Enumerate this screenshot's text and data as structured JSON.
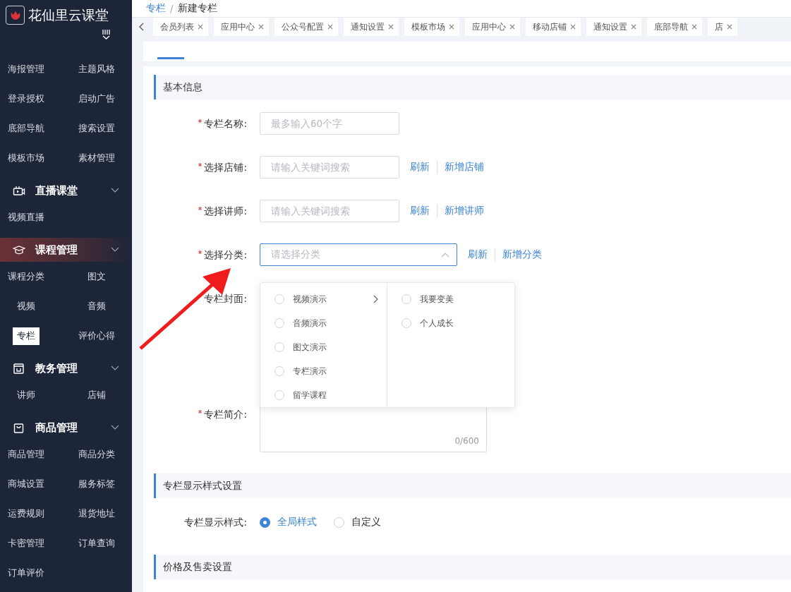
{
  "app": {
    "name": "花仙里云课堂"
  },
  "sidebar": {
    "sections": [
      {
        "kind": "grid",
        "items": [
          {
            "label": "海报管理",
            "selected": false
          },
          {
            "label": "主题风格",
            "selected": false
          },
          {
            "label": "登录授权",
            "selected": false
          },
          {
            "label": "启动广告",
            "selected": false
          },
          {
            "label": "底部导航",
            "selected": false
          },
          {
            "label": "搜索设置",
            "selected": false
          },
          {
            "label": "模板市场",
            "selected": false
          },
          {
            "label": "素材管理",
            "selected": false
          }
        ]
      },
      {
        "kind": "group",
        "title": "直播课堂",
        "active": false,
        "items": [
          {
            "label": "视频直播",
            "selected": false
          }
        ]
      },
      {
        "kind": "group",
        "title": "课程管理",
        "active": true,
        "items": [
          {
            "label": "课程分类",
            "selected": false
          },
          {
            "label": "图文",
            "selected": false
          },
          {
            "label": "视频",
            "selected": false
          },
          {
            "label": "音频",
            "selected": false
          },
          {
            "label": "专栏",
            "selected": true
          },
          {
            "label": "评价心得",
            "selected": false
          }
        ]
      },
      {
        "kind": "group",
        "title": "教务管理",
        "active": false,
        "items": [
          {
            "label": "讲师",
            "selected": false
          },
          {
            "label": "店铺",
            "selected": false
          }
        ]
      },
      {
        "kind": "group",
        "title": "商品管理",
        "active": false,
        "items": [
          {
            "label": "商品管理",
            "selected": false
          },
          {
            "label": "商品分类",
            "selected": false
          },
          {
            "label": "商城设置",
            "selected": false
          },
          {
            "label": "服务标签",
            "selected": false
          },
          {
            "label": "运费规则",
            "selected": false
          },
          {
            "label": "退货地址",
            "selected": false
          },
          {
            "label": "卡密管理",
            "selected": false
          },
          {
            "label": "订单查询",
            "selected": false
          },
          {
            "label": "订单评价",
            "selected": false
          }
        ]
      }
    ]
  },
  "breadcrumb": {
    "items": [
      {
        "label": "专栏",
        "link": true
      },
      {
        "label": "新建专栏",
        "link": false
      }
    ],
    "separator": "/"
  },
  "open_tabs": [
    {
      "label": "会员列表"
    },
    {
      "label": "应用中心"
    },
    {
      "label": "公众号配置"
    },
    {
      "label": "通知设置"
    },
    {
      "label": "模板市场"
    },
    {
      "label": "应用中心"
    },
    {
      "label": "移动店铺"
    },
    {
      "label": "通知设置"
    },
    {
      "label": "底部导航"
    },
    {
      "label": "店"
    }
  ],
  "sections": [
    {
      "title": "基本信息",
      "fields": [
        {
          "kind": "text",
          "label": "专栏名称:",
          "required": true,
          "placeholder": "最多输入60个字"
        },
        {
          "kind": "text",
          "label": "选择店铺:",
          "required": true,
          "placeholder": "请输入关键词搜索",
          "links": [
            "刷新",
            "新增店铺"
          ]
        },
        {
          "kind": "text",
          "label": "选择讲师:",
          "required": true,
          "placeholder": "请输入关键词搜索",
          "links": [
            "刷新",
            "新增讲师"
          ]
        },
        {
          "kind": "select",
          "label": "选择分类:",
          "required": true,
          "placeholder": "请选择分类",
          "expanded": true,
          "links": [
            "刷新",
            "新增分类"
          ],
          "options": [
            [
              {
                "label": "视频演示",
                "has_children": true,
                "selected": false
              },
              {
                "label": "音频演示",
                "has_children": false,
                "selected": false
              },
              {
                "label": "图文演示",
                "has_children": false,
                "selected": false
              },
              {
                "label": "专栏演示",
                "has_children": false,
                "selected": false
              },
              {
                "label": "留学课程",
                "has_children": false,
                "selected": false
              }
            ],
            [
              {
                "label": "我要变美",
                "has_children": false,
                "selected": false
              },
              {
                "label": "个人成长",
                "has_children": false,
                "selected": false
              }
            ]
          ]
        },
        {
          "kind": "cover",
          "label": "专栏封面:",
          "required": false
        },
        {
          "kind": "textarea",
          "label": "专栏简介:",
          "required": true,
          "counter": "0/600"
        }
      ]
    },
    {
      "title": "专栏显示样式设置",
      "fields": [
        {
          "kind": "radio",
          "label": "专栏显示样式:",
          "required": false,
          "options": [
            {
              "label": "全局样式",
              "selected": true
            },
            {
              "label": "自定义",
              "selected": false
            }
          ]
        }
      ]
    },
    {
      "title": "价格及售卖设置"
    }
  ]
}
